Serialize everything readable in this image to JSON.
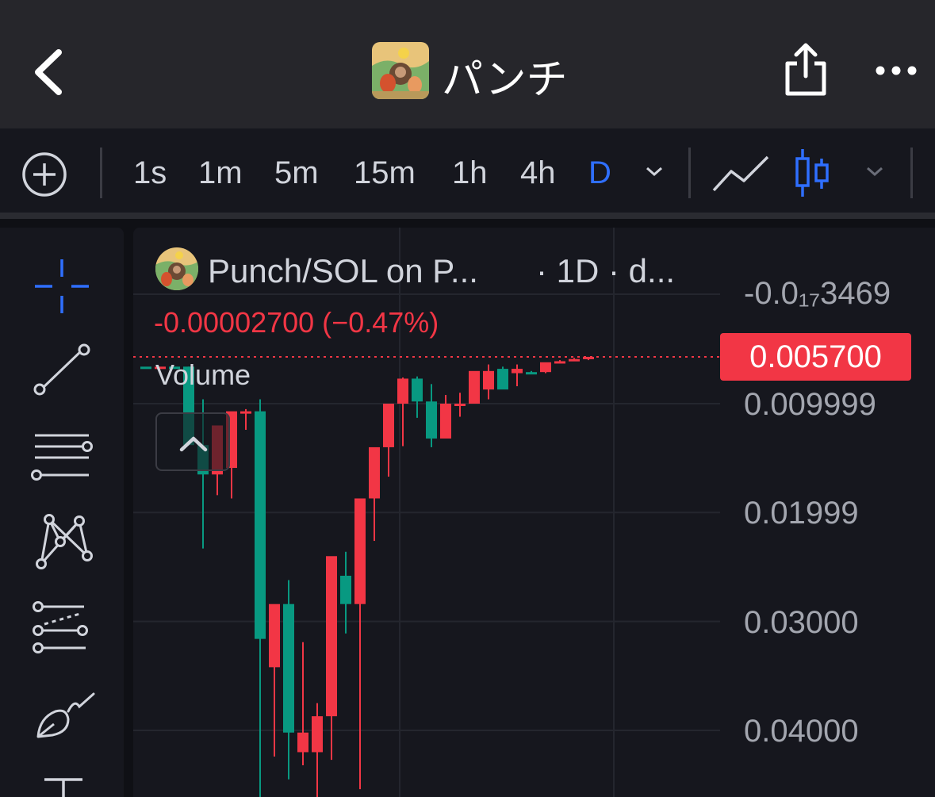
{
  "nav": {
    "title": "パンチ",
    "icons": [
      "back-chevron-icon",
      "coin-avatar",
      "share-icon",
      "more-icon"
    ]
  },
  "toolbar": {
    "intervals": [
      "1s",
      "1m",
      "5m",
      "15m",
      "1h",
      "4h",
      "D"
    ],
    "selected_interval": "D",
    "icons": [
      "add-indicator-icon",
      "chevron-down-icon",
      "line-chart-icon",
      "candlestick-icon",
      "chevron-down-icon"
    ]
  },
  "drawing_tools": [
    "crosshair-icon",
    "trend-line-icon",
    "horizontal-lines-icon",
    "pattern-icon",
    "fib-tool-icon",
    "brush-icon",
    "text-tool-icon"
  ],
  "legend": {
    "pair": "Punch/SOL on P...",
    "timeframe": "· 1D · d...",
    "change": "-0.00002700 (−0.47%)",
    "volume_label": "Volume"
  },
  "price_axis": {
    "labels": [
      "-0.0₁₇3469",
      "0.009999",
      "0.01999",
      "0.03000",
      "0.04000"
    ],
    "current_price": "0.005700"
  },
  "colors": {
    "up": "#089981",
    "down": "#f23645",
    "accent": "#2f6fff",
    "background": "#16171e",
    "nav_background": "#26262b"
  },
  "chart_data": {
    "type": "candlestick",
    "inverted_price_axis": true,
    "y_ticks": [
      0.009999,
      0.01999,
      0.03,
      0.04
    ],
    "current_price": 0.0057,
    "ohlc": [
      {
        "o": 0.0066,
        "h": 0.0066,
        "l": 0.0066,
        "c": 0.0066,
        "dir": "up"
      },
      {
        "o": 0.0066,
        "h": 0.0066,
        "l": 0.0066,
        "c": 0.0066,
        "dir": "down"
      },
      {
        "o": 0.0066,
        "h": 0.0067,
        "l": 0.0066,
        "c": 0.0066,
        "dir": "up"
      },
      {
        "o": 0.0066,
        "h": 0.0066,
        "l": 0.0138,
        "c": 0.0138,
        "dir": "up"
      },
      {
        "o": 0.0138,
        "h": 0.0096,
        "l": 0.0233,
        "c": 0.0165,
        "dir": "up"
      },
      {
        "o": 0.0165,
        "h": 0.0151,
        "l": 0.0184,
        "c": 0.012,
        "dir": "down"
      },
      {
        "o": 0.0159,
        "h": 0.0115,
        "l": 0.0187,
        "c": 0.0107,
        "dir": "down"
      },
      {
        "o": 0.0107,
        "h": 0.0105,
        "l": 0.0124,
        "c": 0.0107,
        "dir": "down"
      },
      {
        "o": 0.0107,
        "h": 0.0096,
        "l": 0.0495,
        "c": 0.0316,
        "dir": "up"
      },
      {
        "o": 0.0342,
        "h": 0.0291,
        "l": 0.0424,
        "c": 0.0284,
        "dir": "down"
      },
      {
        "o": 0.0284,
        "h": 0.0262,
        "l": 0.0445,
        "c": 0.0402,
        "dir": "up"
      },
      {
        "o": 0.0402,
        "h": 0.0319,
        "l": 0.0432,
        "c": 0.042,
        "dir": "down"
      },
      {
        "o": 0.042,
        "h": 0.0375,
        "l": 0.0501,
        "c": 0.0387,
        "dir": "down"
      },
      {
        "o": 0.0387,
        "h": 0.0261,
        "l": 0.0427,
        "c": 0.024,
        "dir": "down"
      },
      {
        "o": 0.0258,
        "h": 0.0236,
        "l": 0.0311,
        "c": 0.0284,
        "dir": "up"
      },
      {
        "o": 0.0284,
        "h": 0.02,
        "l": 0.0454,
        "c": 0.0187,
        "dir": "down"
      },
      {
        "o": 0.0187,
        "h": 0.0172,
        "l": 0.0226,
        "c": 0.014,
        "dir": "down"
      },
      {
        "o": 0.014,
        "h": 0.0113,
        "l": 0.0167,
        "c": 0.01,
        "dir": "down"
      },
      {
        "o": 0.01,
        "h": 0.0076,
        "l": 0.0139,
        "c": 0.0077,
        "dir": "down"
      },
      {
        "o": 0.0077,
        "h": 0.0075,
        "l": 0.0113,
        "c": 0.0098,
        "dir": "up"
      },
      {
        "o": 0.0098,
        "h": 0.0082,
        "l": 0.014,
        "c": 0.0132,
        "dir": "up"
      },
      {
        "o": 0.0132,
        "h": 0.0092,
        "l": 0.0123,
        "c": 0.01,
        "dir": "down"
      },
      {
        "o": 0.01,
        "h": 0.009,
        "l": 0.0112,
        "c": 0.01,
        "dir": "down"
      },
      {
        "o": 0.01,
        "h": 0.0072,
        "l": 0.0098,
        "c": 0.007,
        "dir": "down"
      },
      {
        "o": 0.007,
        "h": 0.0064,
        "l": 0.0096,
        "c": 0.0087,
        "dir": "down"
      },
      {
        "o": 0.0087,
        "h": 0.0066,
        "l": 0.0084,
        "c": 0.0068,
        "dir": "up"
      },
      {
        "o": 0.0068,
        "h": 0.0064,
        "l": 0.0084,
        "c": 0.0072,
        "dir": "down"
      },
      {
        "o": 0.0072,
        "h": 0.007,
        "l": 0.0072,
        "c": 0.0071,
        "dir": "up"
      },
      {
        "o": 0.0071,
        "h": 0.0064,
        "l": 0.0072,
        "c": 0.0062,
        "dir": "down"
      },
      {
        "o": 0.0062,
        "h": 0.006,
        "l": 0.0063,
        "c": 0.0061,
        "dir": "down"
      },
      {
        "o": 0.0061,
        "h": 0.0058,
        "l": 0.0061,
        "c": 0.0059,
        "dir": "down"
      },
      {
        "o": 0.0059,
        "h": 0.0057,
        "l": 0.006,
        "c": 0.0057,
        "dir": "down"
      }
    ]
  }
}
